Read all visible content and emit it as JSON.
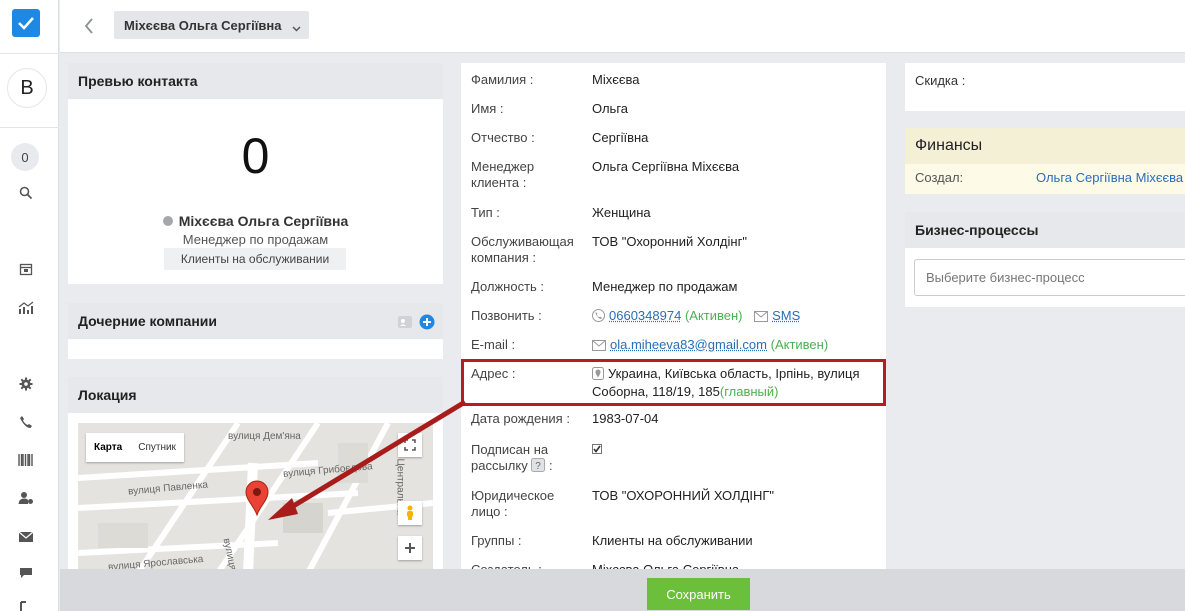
{
  "nav": {
    "avatar_letter": "В",
    "notification_count": "0"
  },
  "header": {
    "contact_name": "Міхєєва Ольга Сергіївна"
  },
  "preview": {
    "title": "Превью контакта",
    "big_value": "0",
    "name": "Міхєєва Ольга Сергіївна",
    "role": "Менеджер по продажам",
    "tag": "Клиенты на обслуживании"
  },
  "child_companies": {
    "title": "Дочерние компании"
  },
  "location": {
    "title": "Локация",
    "map_tab_map": "Карта",
    "map_tab_satellite": "Спутник",
    "streets": [
      "вулиця Дем'яна",
      "вулиця Павленка",
      "вулиця Грибоєдова",
      "вулиця Соборна",
      "вулиця Ярославська",
      "Центральна"
    ]
  },
  "form": {
    "last_name": {
      "label": "Фамилия :",
      "value": "Міхєєва"
    },
    "first_name": {
      "label": "Имя :",
      "value": "Ольга"
    },
    "patronymic": {
      "label": "Отчество :",
      "value": "Сергіївна"
    },
    "manager": {
      "label": "Менеджер клиента :",
      "value": "Ольга Сергіївна Міхєєва"
    },
    "type": {
      "label": "Тип :",
      "value": "Женщина"
    },
    "company": {
      "label": "Обслуживающая компания :",
      "value": "ТОВ \"Охоронний Холдінг\""
    },
    "position": {
      "label": "Должность :",
      "value": "Менеджер по продажам"
    },
    "phone": {
      "label": "Позвонить :",
      "value": "0660348974",
      "status": "(Активен)",
      "sms": "SMS"
    },
    "email": {
      "label": "E-mail :",
      "value": "ola.miheeva83@gmail.com",
      "status": "(Активен)"
    },
    "address": {
      "label": "Адрес :",
      "value": "Украина, Київська область, Ірпінь, вулиця Соборна, 118/19, 185",
      "main": "(главный)"
    },
    "birth_date": {
      "label": "Дата рождения :",
      "value": "1983-07-04"
    },
    "newsletter": {
      "label": "Подписан на рассылку",
      "suffix": ":"
    },
    "legal_entity": {
      "label": "Юридическое лицо :",
      "value": "ТОВ \"ОХОРОННИЙ ХОЛДІНГ\""
    },
    "groups": {
      "label": "Группы :",
      "value": "Клиенты на обслуживании"
    },
    "creator": {
      "label": "Создатель :",
      "value": "Міхєєва Ольга Сергіївна"
    }
  },
  "sidebar_right": {
    "discount_label": "Скидка :",
    "finance_title": "Финансы",
    "created_label": "Создал:",
    "created_value": "Ольга Сергіївна Міхєєва",
    "bp_title": "Бизнес-процессы",
    "bp_placeholder": "Выберите бизнес-процесс"
  },
  "footer": {
    "save_label": "Сохранить"
  },
  "colors": {
    "accent": "#1e88e5",
    "link": "#2a6db5",
    "save": "#6bbf3a",
    "highlight": "#b51e1e",
    "active": "#4caf50"
  }
}
